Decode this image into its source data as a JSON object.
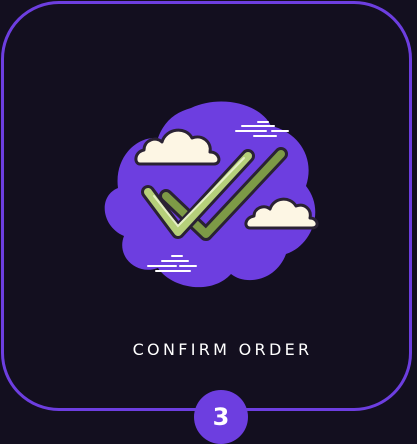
{
  "step": {
    "label": "CONFIRM ORDER",
    "number": "3"
  },
  "illustration": {
    "icon": "double-checkmark-icon",
    "blob_color": "#6d3ee0",
    "check_color": "#a8c66c",
    "cloud_color": "#fdf6e4"
  },
  "colors": {
    "background": "#130f1f",
    "accent": "#6d3ee0",
    "text": "#ffffff"
  }
}
